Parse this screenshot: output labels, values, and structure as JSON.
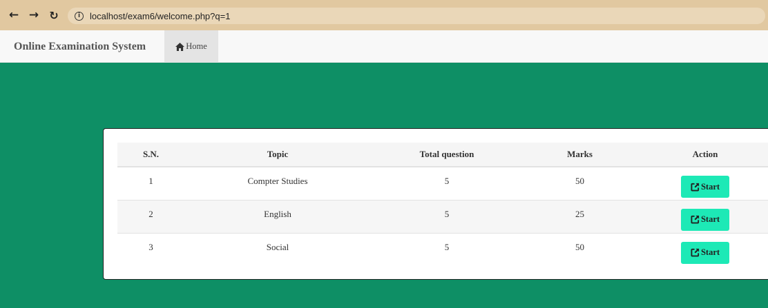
{
  "browser": {
    "back_icon": "arrow-left-icon",
    "forward_icon": "arrow-right-icon",
    "reload_icon": "reload-icon",
    "url": "localhost/exam6/welcome.php?q=1"
  },
  "navbar": {
    "brand": "Online Examination System",
    "home_label": "Home"
  },
  "table": {
    "headers": {
      "sn": "S.N.",
      "topic": "Topic",
      "total_question": "Total question",
      "marks": "Marks",
      "action": "Action"
    },
    "rows": [
      {
        "sn": "1",
        "topic": "Compter Studies",
        "total_question": "5",
        "marks": "50",
        "action": "Start"
      },
      {
        "sn": "2",
        "topic": "English",
        "total_question": "5",
        "marks": "25",
        "action": "Start"
      },
      {
        "sn": "3",
        "topic": "Social",
        "total_question": "5",
        "marks": "50",
        "action": "Start"
      }
    ]
  },
  "colors": {
    "page_background": "#0e8f65",
    "browser_bar": "#e1c8a0",
    "start_button": "#1de9b6"
  }
}
